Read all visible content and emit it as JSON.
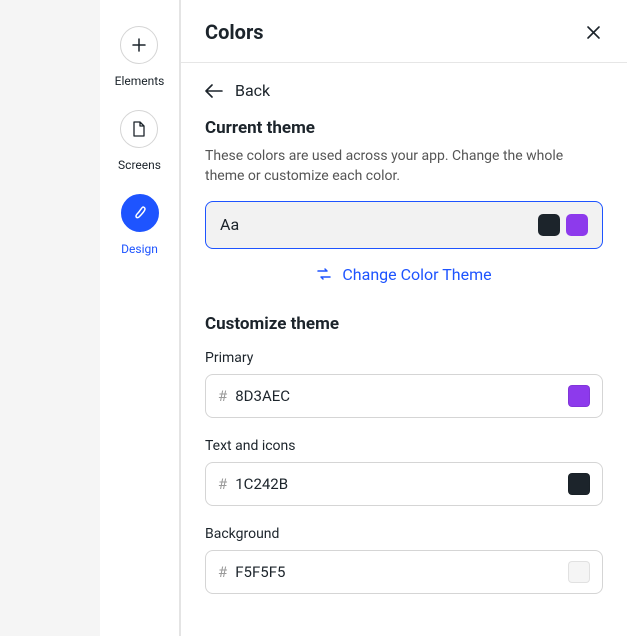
{
  "nav": {
    "items": [
      {
        "label": "Elements"
      },
      {
        "label": "Screens"
      },
      {
        "label": "Design"
      }
    ]
  },
  "panel": {
    "title": "Colors",
    "back_label": "Back"
  },
  "current_theme": {
    "heading": "Current theme",
    "description": "These colors are used across your app. Change the whole theme or customize each color.",
    "sample": "Aa",
    "swatch_text": "#1c242b",
    "swatch_primary": "#8D3AEC",
    "change_label": "Change Color Theme"
  },
  "customize": {
    "heading": "Customize theme",
    "fields": [
      {
        "label": "Primary",
        "value": "8D3AEC",
        "color": "#8D3AEC"
      },
      {
        "label": "Text and icons",
        "value": "1C242B",
        "color": "#1C242B"
      },
      {
        "label": "Background",
        "value": "F5F5F5",
        "color": "#F5F5F5"
      }
    ]
  }
}
